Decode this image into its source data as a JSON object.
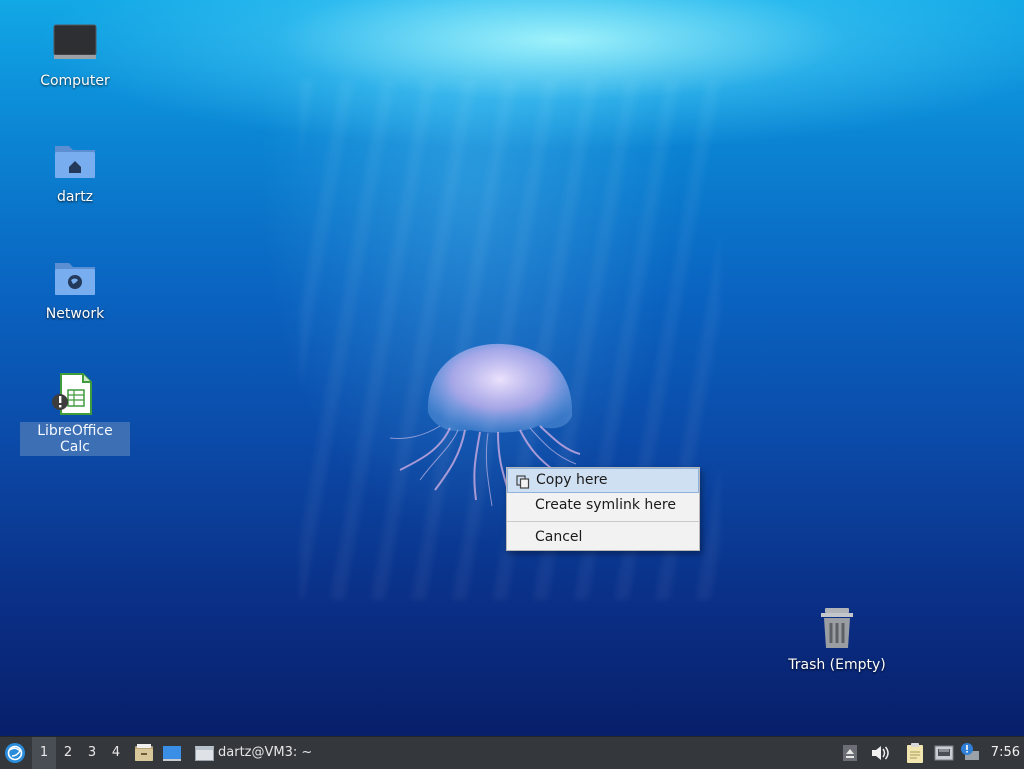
{
  "desktop": {
    "icons": [
      {
        "label": "Computer",
        "icon": "computer-icon"
      },
      {
        "label": "dartz",
        "icon": "home-folder-icon"
      },
      {
        "label": "Network",
        "icon": "network-folder-icon"
      },
      {
        "label": "LibreOffice Calc",
        "icon": "libreoffice-calc-icon",
        "selected": true
      },
      {
        "label": "Trash (Empty)",
        "icon": "trash-icon"
      }
    ]
  },
  "context_menu": {
    "items": [
      {
        "label": "Copy here",
        "icon": "copy-icon",
        "highlighted": true
      },
      {
        "label": "Create symlink here"
      },
      {
        "label": "Cancel"
      }
    ]
  },
  "panel": {
    "workspaces": [
      "1",
      "2",
      "3",
      "4"
    ],
    "active_workspace": "1",
    "task_label": "dartz@VM3: ~",
    "clock": "7:56",
    "colors": {
      "panel_bg": "#34373c",
      "selection": "#3c6fb4",
      "menu_highlight": "#cfe0f3"
    }
  }
}
